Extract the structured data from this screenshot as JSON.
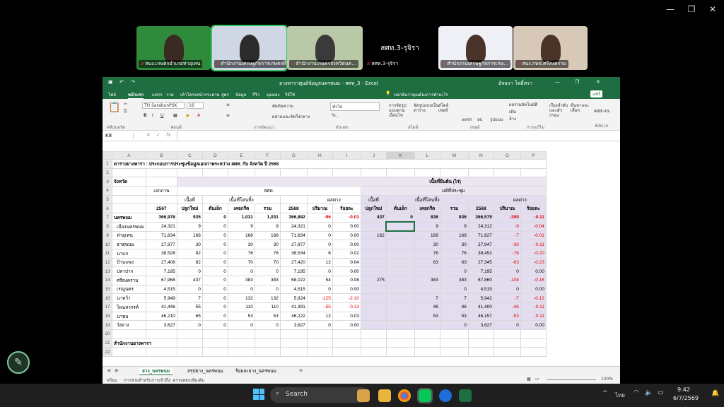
{
  "meet": {
    "tiles": [
      {
        "label": "สนง.เกษตรอำเภอท่าอุเทน",
        "bg": "#2e8b3c"
      },
      {
        "label": "สำนักงานเศรษฐกิจการเกษตรที่...",
        "bg": "#cfd6e4"
      },
      {
        "label": "สำนักงานเกษตรจังหวัดนค...",
        "bg": "#b9c9a8"
      },
      {
        "label": "สศท.3-รุจิรา",
        "bg": "#2a2a2a"
      },
      {
        "label": "สำนักงานเศรษฐกิจการเกษ...",
        "bg": "#eef0f5"
      },
      {
        "label": "สนง.กษจ.ศรีสงคราม",
        "bg": "#d8c8b8"
      }
    ],
    "featured_name": "สศท.3-รุจิรา"
  },
  "excel": {
    "title": "ยางพาราศูนย์ข้อมูลนครพนม - สศท_3 - Excel",
    "user": "อัจฉรา โพธิ์ทรา",
    "tabs": [
      "ไฟล์",
      "หน้าแรก",
      "แทรก",
      "วาด",
      "เค้าโครงหน้ากระดาษ",
      "สูตร",
      "ข้อมูล",
      "รีวิว",
      "มุมมอง",
      "วิธีใช้"
    ],
    "tell_me": "บอกฉันว่าคุณต้องการทำอะไร",
    "share": "แชร์",
    "ribbon": {
      "font_name": "TH SarabunPSK",
      "font_size": "16",
      "wrap": "ตัดข้อความ",
      "merge": "ผสานและจัดกึ่งกลาง",
      "number_format": "ทั่วไป",
      "cond_format": "การจัดรูปแบบตามเงื่อนไข",
      "format_table": "จัดรูปแบบเป็นตาราง",
      "cell_styles": "สไตล์เซลล์",
      "insert": "แทรก",
      "delete": "ลบ",
      "format": "รูปแบบ",
      "sum": "ผลรวมอัตโนมัติ",
      "fill": "เติม",
      "clear": "ล้าง",
      "sort": "เรียงลำดับและตัวกรอง",
      "find": "ค้นหาและเลือก",
      "addins": "Add-ins",
      "groups": [
        "คลิปบอร์ด",
        "ฟอนต์",
        "การจัดแนว",
        "ตัวเลข",
        "สไตล์",
        "เซลล์",
        "การแก้ไข",
        "Add-in"
      ]
    },
    "namebox": "K8",
    "columns": [
      "A",
      "B",
      "C",
      "D",
      "E",
      "F",
      "G",
      "H",
      "I",
      "J",
      "K",
      "L",
      "M",
      "N",
      "O",
      "P"
    ],
    "sheet": {
      "row1_title": "ตารางยางพารา : ประกอบการประชุมข้อมูลเอกภาพระหว่าง สศท. กับ จังหวัด ปี 2568",
      "row3_province": "จังหวัด",
      "row3_area": "เนื้อที่ยืนต้น  (ไร่)",
      "row4_ekaphap": "เอกภาพ",
      "row4_oae": "สศท.",
      "row4_meeting": "มติที่ประชุม",
      "row5_new": "เนื้อที่",
      "row5_cut": "เนื้อที่โค่นทิ้ง",
      "row5_diff": "ผลต่าง",
      "row6": [
        "2567",
        "ปลูกใหม่",
        "ต้นเล็ก",
        "เคยกรีด",
        "รวม",
        "2568",
        "ปริมาณ",
        "ร้อยละ",
        "ปลูกใหม่",
        "ต้นเล็ก",
        "เคยกรีด",
        "รวม",
        "2568",
        "ปริมาณ",
        "ร้อยละ"
      ],
      "rows": [
        {
          "n": "7",
          "name": "นครพนม",
          "v": [
            "366,978",
            "935",
            "0",
            "1,031",
            "1,031",
            "366,882",
            "-96",
            "-0.03",
            "437",
            "0",
            "836",
            "836",
            "366,579",
            "-399",
            "-0.11"
          ]
        },
        {
          "n": "8",
          "name": "เมืองนครพนม",
          "v": [
            "24,321",
            "9",
            "0",
            "9",
            "9",
            "24,321",
            "0",
            "0.00",
            "",
            "",
            "9",
            "9",
            "24,312",
            "-9",
            "-0.04"
          ]
        },
        {
          "n": "9",
          "name": "ท่าอุเทน",
          "v": [
            "71,834",
            "168",
            "0",
            "168",
            "168",
            "71,834",
            "0",
            "0.00",
            "162",
            "",
            "169",
            "169",
            "71,827",
            "-7",
            "-0.01"
          ]
        },
        {
          "n": "10",
          "name": "ธาตุพนม",
          "v": [
            "27,977",
            "30",
            "0",
            "30",
            "30",
            "27,977",
            "0",
            "0.00",
            "",
            "",
            "30",
            "30",
            "27,947",
            "-30",
            "-0.11"
          ]
        },
        {
          "n": "11",
          "name": "นาแก",
          "v": [
            "38,528",
            "82",
            "0",
            "76",
            "76",
            "38,534",
            "6",
            "0.02",
            "",
            "",
            "76",
            "76",
            "38,452",
            "-76",
            "-0.20"
          ]
        },
        {
          "n": "12",
          "name": "บ้านแพง",
          "v": [
            "27,408",
            "82",
            "0",
            "70",
            "70",
            "27,420",
            "12",
            "0.04",
            "",
            "",
            "63",
            "63",
            "27,345",
            "-63",
            "-0.23"
          ]
        },
        {
          "n": "13",
          "name": "ปลาปาก",
          "v": [
            "7,195",
            "0",
            "0",
            "0",
            "0",
            "7,195",
            "0",
            "0.00",
            "",
            "",
            "",
            "0",
            "7,195",
            "0",
            "0.00"
          ]
        },
        {
          "n": "14",
          "name": "ศรีสงคราม",
          "v": [
            "67,968",
            "437",
            "0",
            "383",
            "383",
            "68,022",
            "54",
            "0.08",
            "275",
            "",
            "383",
            "383",
            "67,860",
            "-108",
            "-0.16"
          ]
        },
        {
          "n": "15",
          "name": "เรณูนคร",
          "v": [
            "4,515",
            "0",
            "0",
            "0",
            "0",
            "4,515",
            "0",
            "0.00",
            "",
            "",
            "",
            "0",
            "4,515",
            "0",
            "0.00"
          ]
        },
        {
          "n": "16",
          "name": "นาหว้า",
          "v": [
            "5,949",
            "7",
            "0",
            "132",
            "132",
            "5,824",
            "-125",
            "-2.10",
            "",
            "",
            "7",
            "7",
            "5,942",
            "-7",
            "-0.12"
          ]
        },
        {
          "n": "17",
          "name": "โพนสวรรค์",
          "v": [
            "41,446",
            "55",
            "0",
            "110",
            "110",
            "41,391",
            "-55",
            "-0.13",
            "",
            "",
            "46",
            "46",
            "41,400",
            "-46",
            "-0.11"
          ]
        },
        {
          "n": "18",
          "name": "นาทม",
          "v": [
            "46,210",
            "65",
            "0",
            "53",
            "53",
            "46,222",
            "12",
            "0.03",
            "",
            "",
            "53",
            "53",
            "46,157",
            "-53",
            "-0.11"
          ]
        },
        {
          "n": "19",
          "name": "วังยาง",
          "v": [
            "3,627",
            "0",
            "0",
            "0",
            "0",
            "3,627",
            "0",
            "0.00",
            "",
            "",
            "",
            "0",
            "3,627",
            "0",
            "0.00"
          ]
        }
      ],
      "row21": "สำนักงานยางพารา"
    },
    "sheet_tabs": [
      "ยาง_นครพนม",
      "สรุปยาง_นครพนม",
      "ร้อยละยาง_นครพนม"
    ],
    "status_ready": "พร้อม",
    "status_access": "การช่วยสำหรับการเข้าถึง: ตรวจสอบเพิ่มเติม",
    "zoom": "100%"
  },
  "taskbar": {
    "search": "Search",
    "lang": "ไทย",
    "time": "9:42",
    "date": "6/7/2569"
  },
  "colors": {
    "excel_green": "#1e6e42",
    "negative": "#e00000",
    "meeting_fill": "#e4dcef"
  }
}
